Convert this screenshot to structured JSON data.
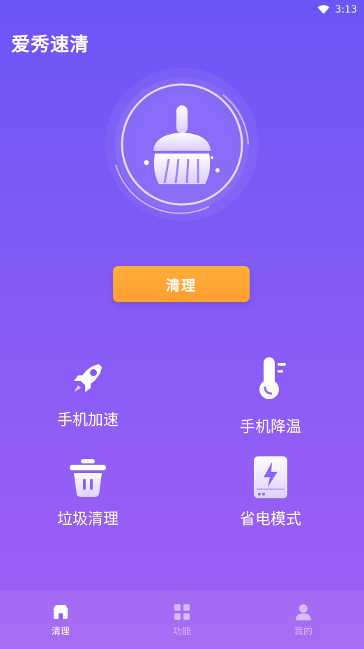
{
  "status_bar": {
    "time": "3:13",
    "wifi_icon": "wifi-icon"
  },
  "app": {
    "title": "爱秀速清"
  },
  "hero": {
    "icon": "broom-icon"
  },
  "clean_button": {
    "label": "清理"
  },
  "features": [
    {
      "label": "手机加速",
      "icon": "rocket-icon"
    },
    {
      "label": "手机降温",
      "icon": "thermometer-icon"
    },
    {
      "label": "垃圾清理",
      "icon": "trash-icon"
    },
    {
      "label": "省电模式",
      "icon": "battery-bolt-icon"
    }
  ],
  "bottom_nav": [
    {
      "label": "清理",
      "icon": "shop-icon",
      "active": true
    },
    {
      "label": "功能",
      "icon": "grid-icon",
      "active": false
    },
    {
      "label": "我的",
      "icon": "user-icon",
      "active": false
    }
  ],
  "colors": {
    "accent": "#ffa233",
    "background_top": "#6c55f6",
    "background_bottom": "#a060f4"
  }
}
